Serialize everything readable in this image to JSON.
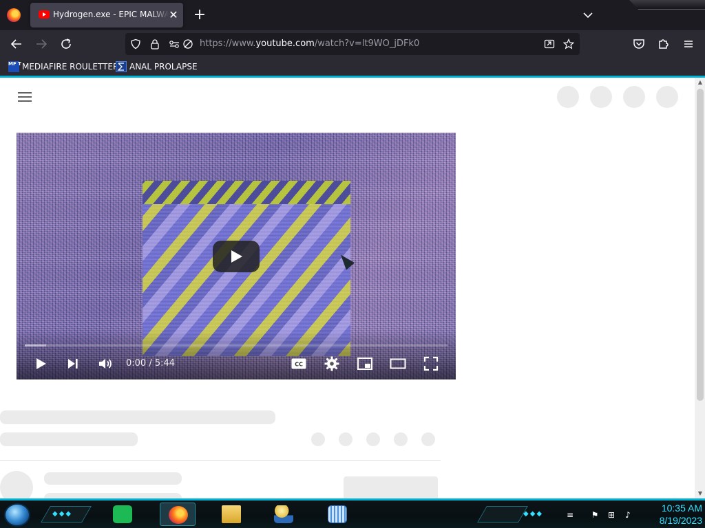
{
  "browser": {
    "tab": {
      "title": "Hydrogen.exe - EPIC MALWARE",
      "close": "✕"
    },
    "new_tab": "+",
    "url": {
      "prefix": "https://www.",
      "host": "youtube.com",
      "path": "/watch?v=lt9WO_jDFk0"
    },
    "bookmarks": [
      {
        "label": "MEDIAFIRE ROULETTER",
        "icon": "mediafire-icon",
        "icon_text": "MF T"
      },
      {
        "label": "ANAL PROLAPSE",
        "icon": "bookmark-sigma-icon"
      }
    ],
    "accent_color": "#00b3d6"
  },
  "video": {
    "current_time": "0:00",
    "duration": "5:44",
    "time_label": "0:00 / 5:44",
    "progress_fraction": 0.0,
    "buffer_fraction": 0.05
  },
  "taskbar": {
    "apps": [
      {
        "name": "sheets-app",
        "color": "#1db954"
      },
      {
        "name": "firefox-app",
        "color": "#ff7a1a",
        "active": true
      },
      {
        "name": "file-explorer-app",
        "color": "#f2c14e"
      },
      {
        "name": "network-app",
        "color": "#7db9e8"
      },
      {
        "name": "keyboard-app",
        "color": "#4a90d9"
      }
    ],
    "clock": {
      "time": "10:35 AM",
      "date": "8/19/2023"
    },
    "accent_color": "#35e0ff"
  }
}
